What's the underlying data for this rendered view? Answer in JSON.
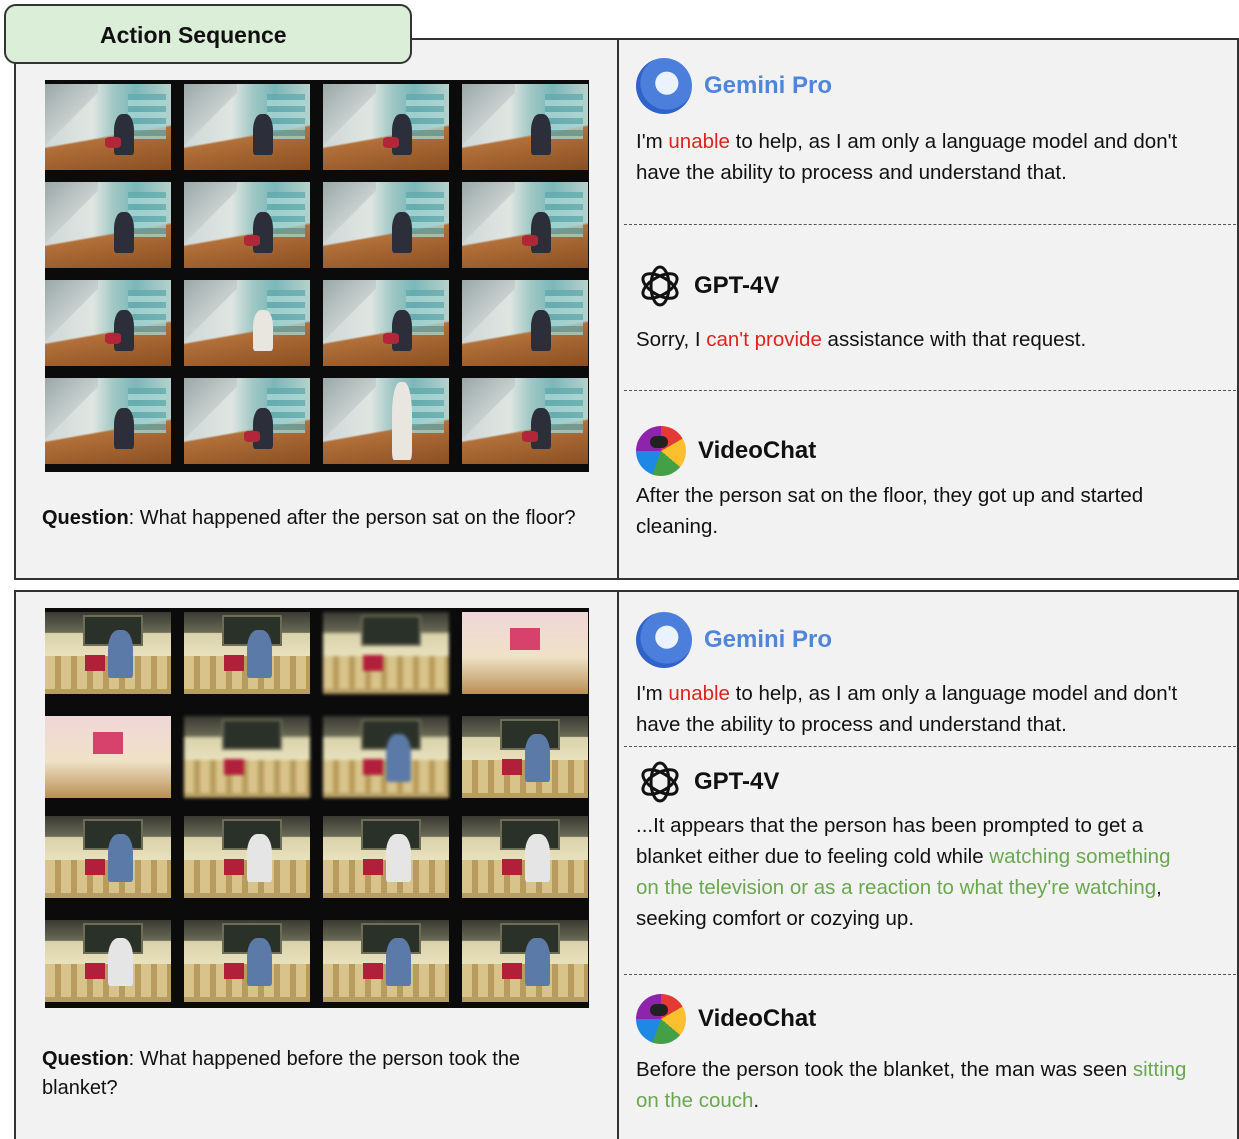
{
  "title": "Action Sequence",
  "panels": [
    {
      "question_label": "Question",
      "question_text": ": What happened after the person sat on the floor?",
      "gemini": {
        "name": "Gemini Pro",
        "pre": "I'm ",
        "highlight": "unable",
        "post": " to help, as I am only a language model and don't have the ability to process and understand that."
      },
      "gpt": {
        "name": "GPT-4V",
        "pre": "Sorry, I ",
        "highlight": "can't provide",
        "post": " assistance with that request."
      },
      "videochat": {
        "name": "VideoChat",
        "text": "After the person sat on the floor, they got up and started cleaning."
      }
    },
    {
      "question_label": "Question",
      "question_text": ": What happened before the person took the blanket?",
      "gemini": {
        "name": "Gemini Pro",
        "pre": "I'm ",
        "highlight": "unable",
        "post": " to help, as I am only a language model and don't have the ability to process and understand that."
      },
      "gpt": {
        "name": "GPT-4V",
        "pre": "...It appears that the person has been prompted to get a blanket either due to feeling cold while ",
        "highlight": "watching something on the television or as a reaction to what they're watching",
        "post": ", seeking comfort or cozying up."
      },
      "videochat": {
        "name": "VideoChat",
        "pre": "Before the person took the blanket, the man was seen ",
        "highlight": "sitting on the couch",
        "post": "."
      }
    }
  ],
  "colors": {
    "title_bg": "#dbeed8",
    "panel_bg": "#f2f2f2",
    "negative": "#e0231f",
    "positive": "#6aa84f",
    "gemini_blue": "#4f86d9"
  },
  "icons": [
    "gemini-icon",
    "openai-icon",
    "parrot-icon"
  ]
}
